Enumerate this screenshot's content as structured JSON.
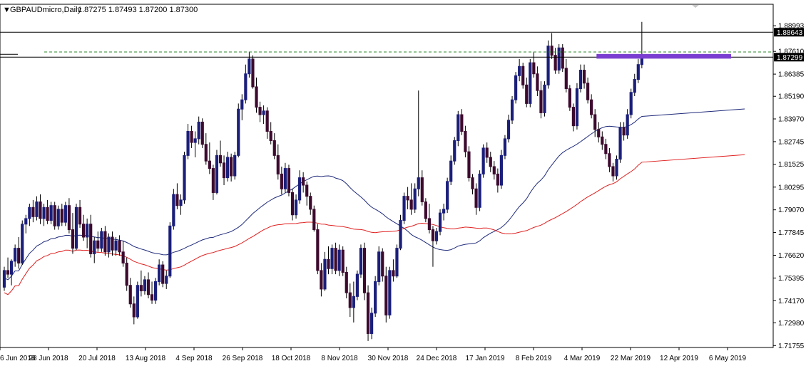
{
  "header": {
    "menu_glyph": "▼",
    "symbol_timeframe": "GBPAUDmicro,Daily",
    "ohlc": "1.87275 1.87493 1.87200 1.87300"
  },
  "colors": {
    "bull_candle": "#1b1f7a",
    "bear_candle": "#3d0a2e",
    "ma_fast": "#1f2a7a",
    "ma_slow": "#e02020",
    "resistance_box": "#7a3fd0",
    "dashed_level": "#2e8b2e",
    "tag_bg": "#000000",
    "tag_text": "#ffffff"
  },
  "chart_data": {
    "type": "candlestick",
    "symbol": "GBPAUDmicro",
    "timeframe": "Daily",
    "ylim": [
      1.7165,
      1.9015
    ],
    "y_ticks": [
      "1.88993",
      "1.87610",
      "1.86385",
      "1.85190",
      "1.83970",
      "1.82745",
      "1.81525",
      "1.80295",
      "1.79070",
      "1.77845",
      "1.76620",
      "1.75395",
      "1.74170",
      "1.72980",
      "1.71755"
    ],
    "x_ticks": [
      "6 Jun 2018",
      "28 Jun 2018",
      "20 Jul 2018",
      "13 Aug 2018",
      "4 Sep 2018",
      "26 Sep 2018",
      "18 Oct 2018",
      "8 Nov 2018",
      "30 Nov 2018",
      "24 Dec 2018",
      "17 Jan 2019",
      "8 Feb 2019",
      "4 Mar 2019",
      "22 Mar 2019",
      "12 Apr 2019",
      "6 May 2019"
    ],
    "price_tags": {
      "high_line": "1.88643",
      "current_line": "1.87299"
    },
    "levels": {
      "high_line": 1.88643,
      "current_line": 1.87299,
      "dashed": 1.8758,
      "box_top": 1.8747,
      "box_bottom": 1.8722,
      "box_start_index": 166,
      "box_end_index": 199
    },
    "candles": [
      [
        1.749,
        1.76,
        1.747,
        1.758
      ],
      [
        1.758,
        1.765,
        1.754,
        1.756
      ],
      [
        1.756,
        1.764,
        1.75,
        1.763
      ],
      [
        1.763,
        1.772,
        1.76,
        1.77
      ],
      [
        1.77,
        1.776,
        1.759,
        1.762
      ],
      [
        1.762,
        1.785,
        1.761,
        1.783
      ],
      [
        1.783,
        1.788,
        1.778,
        1.786
      ],
      [
        1.786,
        1.794,
        1.782,
        1.792
      ],
      [
        1.792,
        1.796,
        1.784,
        1.787
      ],
      [
        1.787,
        1.798,
        1.785,
        1.795
      ],
      [
        1.795,
        1.799,
        1.783,
        1.786
      ],
      [
        1.786,
        1.794,
        1.782,
        1.792
      ],
      [
        1.792,
        1.796,
        1.783,
        1.785
      ],
      [
        1.785,
        1.795,
        1.783,
        1.793
      ],
      [
        1.793,
        1.795,
        1.78,
        1.782
      ],
      [
        1.782,
        1.793,
        1.78,
        1.791
      ],
      [
        1.791,
        1.794,
        1.782,
        1.784
      ],
      [
        1.784,
        1.795,
        1.782,
        1.793
      ],
      [
        1.793,
        1.797,
        1.778,
        1.78
      ],
      [
        1.78,
        1.789,
        1.767,
        1.77
      ],
      [
        1.77,
        1.794,
        1.769,
        1.792
      ],
      [
        1.792,
        1.796,
        1.781,
        1.783
      ],
      [
        1.783,
        1.788,
        1.774,
        1.776
      ],
      [
        1.776,
        1.786,
        1.77,
        1.783
      ],
      [
        1.783,
        1.788,
        1.765,
        1.767
      ],
      [
        1.767,
        1.776,
        1.762,
        1.774
      ],
      [
        1.774,
        1.779,
        1.768,
        1.77
      ],
      [
        1.77,
        1.781,
        1.768,
        1.779
      ],
      [
        1.779,
        1.782,
        1.766,
        1.768
      ],
      [
        1.768,
        1.778,
        1.765,
        1.776
      ],
      [
        1.776,
        1.779,
        1.766,
        1.769
      ],
      [
        1.769,
        1.776,
        1.766,
        1.774
      ],
      [
        1.774,
        1.777,
        1.766,
        1.768
      ],
      [
        1.768,
        1.774,
        1.76,
        1.762
      ],
      [
        1.762,
        1.765,
        1.747,
        1.75
      ],
      [
        1.75,
        1.754,
        1.738,
        1.74
      ],
      [
        1.74,
        1.744,
        1.729,
        1.733
      ],
      [
        1.733,
        1.752,
        1.732,
        1.75
      ],
      [
        1.75,
        1.758,
        1.744,
        1.747
      ],
      [
        1.747,
        1.755,
        1.745,
        1.753
      ],
      [
        1.753,
        1.757,
        1.743,
        1.745
      ],
      [
        1.745,
        1.752,
        1.74,
        1.742
      ],
      [
        1.742,
        1.754,
        1.74,
        1.752
      ],
      [
        1.752,
        1.764,
        1.75,
        1.761
      ],
      [
        1.761,
        1.763,
        1.749,
        1.751
      ],
      [
        1.751,
        1.758,
        1.748,
        1.755
      ],
      [
        1.755,
        1.784,
        1.754,
        1.782
      ],
      [
        1.782,
        1.802,
        1.78,
        1.799
      ],
      [
        1.799,
        1.805,
        1.791,
        1.793
      ],
      [
        1.793,
        1.799,
        1.788,
        1.796
      ],
      [
        1.796,
        1.822,
        1.794,
        1.82
      ],
      [
        1.82,
        1.837,
        1.818,
        1.833
      ],
      [
        1.833,
        1.836,
        1.824,
        1.827
      ],
      [
        1.827,
        1.833,
        1.819,
        1.829
      ],
      [
        1.829,
        1.841,
        1.826,
        1.838
      ],
      [
        1.838,
        1.84,
        1.824,
        1.826
      ],
      [
        1.826,
        1.832,
        1.815,
        1.817
      ],
      [
        1.817,
        1.827,
        1.81,
        1.813
      ],
      [
        1.813,
        1.815,
        1.796,
        1.8
      ],
      [
        1.8,
        1.823,
        1.799,
        1.82
      ],
      [
        1.82,
        1.828,
        1.814,
        1.816
      ],
      [
        1.816,
        1.82,
        1.804,
        1.808
      ],
      [
        1.808,
        1.822,
        1.806,
        1.819
      ],
      [
        1.819,
        1.821,
        1.806,
        1.809
      ],
      [
        1.809,
        1.822,
        1.807,
        1.82
      ],
      [
        1.82,
        1.848,
        1.819,
        1.845
      ],
      [
        1.845,
        1.853,
        1.839,
        1.85
      ],
      [
        1.85,
        1.869,
        1.848,
        1.864
      ],
      [
        1.864,
        1.876,
        1.862,
        1.872
      ],
      [
        1.872,
        1.874,
        1.856,
        1.857
      ],
      [
        1.857,
        1.862,
        1.843,
        1.846
      ],
      [
        1.846,
        1.849,
        1.838,
        1.842
      ],
      [
        1.842,
        1.847,
        1.837,
        1.844
      ],
      [
        1.844,
        1.846,
        1.829,
        1.833
      ],
      [
        1.833,
        1.838,
        1.826,
        1.828
      ],
      [
        1.828,
        1.832,
        1.818,
        1.82
      ],
      [
        1.82,
        1.826,
        1.807,
        1.81
      ],
      [
        1.81,
        1.814,
        1.799,
        1.802
      ],
      [
        1.802,
        1.816,
        1.8,
        1.813
      ],
      [
        1.813,
        1.815,
        1.798,
        1.8
      ],
      [
        1.8,
        1.802,
        1.785,
        1.788
      ],
      [
        1.788,
        1.799,
        1.786,
        1.796
      ],
      [
        1.796,
        1.812,
        1.794,
        1.808
      ],
      [
        1.808,
        1.811,
        1.8,
        1.804
      ],
      [
        1.804,
        1.806,
        1.793,
        1.798
      ],
      [
        1.798,
        1.8,
        1.788,
        1.791
      ],
      [
        1.791,
        1.793,
        1.779,
        1.78
      ],
      [
        1.78,
        1.783,
        1.756,
        1.758
      ],
      [
        1.758,
        1.762,
        1.744,
        1.748
      ],
      [
        1.748,
        1.768,
        1.747,
        1.764
      ],
      [
        1.764,
        1.771,
        1.756,
        1.759
      ],
      [
        1.759,
        1.772,
        1.756,
        1.77
      ],
      [
        1.77,
        1.773,
        1.756,
        1.758
      ],
      [
        1.758,
        1.772,
        1.755,
        1.769
      ],
      [
        1.769,
        1.771,
        1.755,
        1.757
      ],
      [
        1.757,
        1.76,
        1.743,
        1.746
      ],
      [
        1.746,
        1.751,
        1.733,
        1.738
      ],
      [
        1.738,
        1.752,
        1.73,
        1.744
      ],
      [
        1.744,
        1.758,
        1.742,
        1.756
      ],
      [
        1.756,
        1.772,
        1.754,
        1.77
      ],
      [
        1.77,
        1.773,
        1.742,
        1.746
      ],
      [
        1.746,
        1.75,
        1.72,
        1.724
      ],
      [
        1.724,
        1.738,
        1.721,
        1.735
      ],
      [
        1.735,
        1.755,
        1.733,
        1.752
      ],
      [
        1.752,
        1.771,
        1.75,
        1.768
      ],
      [
        1.768,
        1.77,
        1.752,
        1.755
      ],
      [
        1.755,
        1.76,
        1.73,
        1.734
      ],
      [
        1.734,
        1.76,
        1.732,
        1.758
      ],
      [
        1.758,
        1.764,
        1.752,
        1.755
      ],
      [
        1.755,
        1.772,
        1.754,
        1.77
      ],
      [
        1.77,
        1.788,
        1.769,
        1.785
      ],
      [
        1.785,
        1.8,
        1.783,
        1.798
      ],
      [
        1.798,
        1.803,
        1.791,
        1.796
      ],
      [
        1.796,
        1.805,
        1.788,
        1.791
      ],
      [
        1.791,
        1.805,
        1.789,
        1.802
      ],
      [
        1.802,
        1.855,
        1.798,
        1.808
      ],
      [
        1.808,
        1.812,
        1.793,
        1.795
      ],
      [
        1.795,
        1.797,
        1.784,
        1.786
      ],
      [
        1.786,
        1.794,
        1.778,
        1.78
      ],
      [
        1.78,
        1.782,
        1.76,
        1.774
      ],
      [
        1.774,
        1.781,
        1.772,
        1.779
      ],
      [
        1.779,
        1.791,
        1.777,
        1.789
      ],
      [
        1.789,
        1.794,
        1.785,
        1.791
      ],
      [
        1.791,
        1.808,
        1.789,
        1.806
      ],
      [
        1.806,
        1.82,
        1.804,
        1.817
      ],
      [
        1.817,
        1.83,
        1.815,
        1.828
      ],
      [
        1.828,
        1.844,
        1.825,
        1.842
      ],
      [
        1.842,
        1.845,
        1.831,
        1.833
      ],
      [
        1.833,
        1.836,
        1.819,
        1.822
      ],
      [
        1.822,
        1.825,
        1.806,
        1.808
      ],
      [
        1.808,
        1.81,
        1.799,
        1.802
      ],
      [
        1.802,
        1.805,
        1.788,
        1.792
      ],
      [
        1.792,
        1.812,
        1.79,
        1.81
      ],
      [
        1.81,
        1.826,
        1.808,
        1.824
      ],
      [
        1.824,
        1.827,
        1.816,
        1.819
      ],
      [
        1.819,
        1.822,
        1.811,
        1.814
      ],
      [
        1.814,
        1.817,
        1.807,
        1.81
      ],
      [
        1.81,
        1.813,
        1.8,
        1.804
      ],
      [
        1.804,
        1.823,
        1.802,
        1.82
      ],
      [
        1.82,
        1.831,
        1.818,
        1.829
      ],
      [
        1.829,
        1.842,
        1.827,
        1.839
      ],
      [
        1.839,
        1.852,
        1.837,
        1.85
      ],
      [
        1.85,
        1.865,
        1.848,
        1.863
      ],
      [
        1.863,
        1.872,
        1.86,
        1.868
      ],
      [
        1.868,
        1.87,
        1.856,
        1.858
      ],
      [
        1.858,
        1.862,
        1.846,
        1.848
      ],
      [
        1.848,
        1.872,
        1.846,
        1.87
      ],
      [
        1.87,
        1.876,
        1.862,
        1.864
      ],
      [
        1.864,
        1.868,
        1.852,
        1.855
      ],
      [
        1.855,
        1.86,
        1.84,
        1.843
      ],
      [
        1.843,
        1.86,
        1.841,
        1.858
      ],
      [
        1.858,
        1.882,
        1.856,
        1.879
      ],
      [
        1.879,
        1.886,
        1.872,
        1.874
      ],
      [
        1.874,
        1.878,
        1.864,
        1.866
      ],
      [
        1.866,
        1.88,
        1.864,
        1.878
      ],
      [
        1.878,
        1.88,
        1.865,
        1.867
      ],
      [
        1.867,
        1.872,
        1.854,
        1.856
      ],
      [
        1.856,
        1.858,
        1.844,
        1.846
      ],
      [
        1.846,
        1.848,
        1.833,
        1.836
      ],
      [
        1.836,
        1.859,
        1.834,
        1.856
      ],
      [
        1.856,
        1.869,
        1.854,
        1.866
      ],
      [
        1.866,
        1.869,
        1.856,
        1.859
      ],
      [
        1.859,
        1.862,
        1.848,
        1.85
      ],
      [
        1.85,
        1.853,
        1.84,
        1.842
      ],
      [
        1.842,
        1.845,
        1.83,
        1.834
      ],
      [
        1.834,
        1.838,
        1.827,
        1.83
      ],
      [
        1.83,
        1.833,
        1.823,
        1.826
      ],
      [
        1.826,
        1.829,
        1.818,
        1.821
      ],
      [
        1.821,
        1.824,
        1.811,
        1.814
      ],
      [
        1.814,
        1.816,
        1.806,
        1.809
      ],
      [
        1.809,
        1.82,
        1.807,
        1.818
      ],
      [
        1.818,
        1.838,
        1.816,
        1.835
      ],
      [
        1.835,
        1.838,
        1.828,
        1.831
      ],
      [
        1.831,
        1.845,
        1.829,
        1.842
      ],
      [
        1.842,
        1.856,
        1.84,
        1.854
      ],
      [
        1.854,
        1.864,
        1.852,
        1.861
      ],
      [
        1.861,
        1.872,
        1.859,
        1.869
      ],
      [
        1.869,
        1.892,
        1.867,
        1.873
      ]
    ]
  }
}
